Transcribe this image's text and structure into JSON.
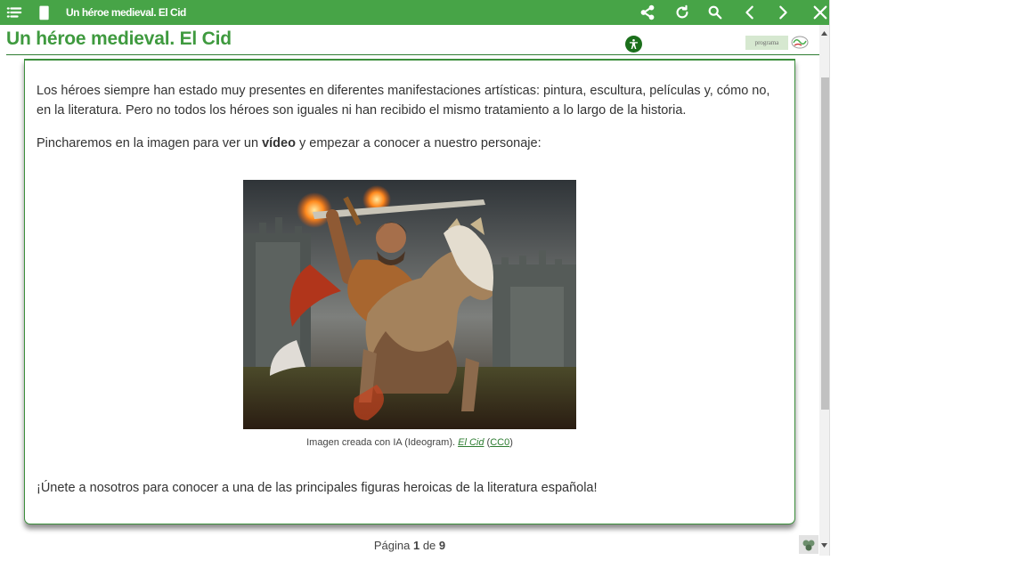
{
  "topbar": {
    "title": "Un héroe medieval. El Cid",
    "icons": [
      "menu-list-icon",
      "book-icon",
      "share-icon",
      "reload-icon",
      "search-icon",
      "chevron-left-icon",
      "chevron-right-icon",
      "close-icon"
    ]
  },
  "header": {
    "title": "Un héroe medieval. El Cid",
    "program_logo_text": "programa"
  },
  "content": {
    "intro": "Los héroes siempre han estado muy presentes en diferentes manifestaciones artísticas: pintura, escultura, películas y, cómo no, en la literatura. Pero no todos los héroes son iguales ni han recibido el mismo tratamiento a lo largo de la historia.",
    "cta_before": "Pincharemos en la imagen para ver un ",
    "cta_bold": "vídeo",
    "cta_after": " y empezar a conocer a nuestro personaje:",
    "image_alt": "Héroe medieval a caballo con una espada en llamas frente a un castillo",
    "caption_text": "Imagen creada con IA (Ideogram). ",
    "caption_link": "El Cid",
    "caption_open": " (",
    "caption_license": "CC0",
    "caption_close": ")",
    "closing": "¡Únete a nosotros para conocer a una de las principales figuras heroicas de la literatura española!"
  },
  "pagination": {
    "prefix": "Página ",
    "current": "1",
    "separator": " de ",
    "total": "9"
  },
  "colors": {
    "topbar": "#47a447",
    "title_green": "#3f9a3f",
    "border_green": "#3c8f3c"
  }
}
